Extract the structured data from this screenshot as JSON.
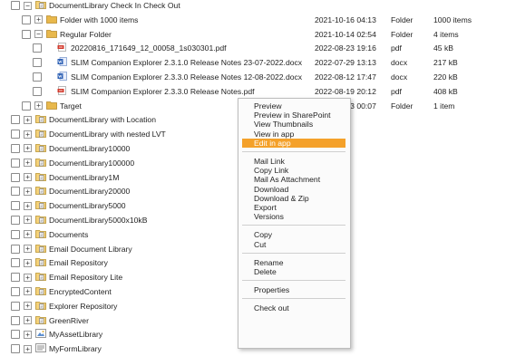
{
  "tree": [
    {
      "indent": 0,
      "expander": "minus",
      "icon": "library",
      "label": "DocumentLibrary Check In Check Out"
    },
    {
      "indent": 1,
      "expander": "plus",
      "icon": "folder",
      "label": "Folder with 1000 items",
      "date": "2021-10-16 04:13",
      "type": "Folder",
      "size": "1000 items"
    },
    {
      "indent": 1,
      "expander": "minus",
      "icon": "folder",
      "label": "Regular Folder",
      "date": "2021-10-14 02:54",
      "type": "Folder",
      "size": "4 items"
    },
    {
      "indent": 2,
      "expander": "",
      "icon": "pdf",
      "label": "20220816_171649_12_00058_1s030301.pdf",
      "date": "2022-08-23 19:16",
      "type": "pdf",
      "size": "45 kB"
    },
    {
      "indent": 2,
      "expander": "",
      "icon": "docx",
      "label": "SLIM Companion Explorer 2.3.1.0 Release Notes 23-07-2022.docx",
      "date": "2022-07-29 13:13",
      "type": "docx",
      "size": "217 kB"
    },
    {
      "indent": 2,
      "expander": "",
      "icon": "docx",
      "label": "SLIM Companion Explorer 2.3.3.0 Release Notes 12-08-2022.docx",
      "date": "2022-08-12 17:47",
      "type": "docx",
      "size": "220 kB"
    },
    {
      "indent": 2,
      "expander": "",
      "icon": "pdf",
      "label": "SLIM Companion Explorer 2.3.3.0 Release Notes.pdf",
      "date": "2022-08-19 20:12",
      "type": "pdf",
      "size": "408 kB"
    },
    {
      "indent": 1,
      "expander": "plus",
      "icon": "folder",
      "label": "Target",
      "date": "2021-10-03 00:07",
      "type": "Folder",
      "size": "1 item"
    },
    {
      "indent": 0,
      "expander": "plus",
      "icon": "library",
      "label": "DocumentLibrary with Location"
    },
    {
      "indent": 0,
      "expander": "plus",
      "icon": "library",
      "label": "DocumentLibrary with nested LVT"
    },
    {
      "indent": 0,
      "expander": "plus",
      "icon": "library",
      "label": "DocumentLibrary10000"
    },
    {
      "indent": 0,
      "expander": "plus",
      "icon": "library",
      "label": "DocumentLibrary100000"
    },
    {
      "indent": 0,
      "expander": "plus",
      "icon": "library",
      "label": "DocumentLibrary1M"
    },
    {
      "indent": 0,
      "expander": "plus",
      "icon": "library",
      "label": "DocumentLibrary20000"
    },
    {
      "indent": 0,
      "expander": "plus",
      "icon": "library",
      "label": "DocumentLibrary5000"
    },
    {
      "indent": 0,
      "expander": "plus",
      "icon": "library",
      "label": "DocumentLibrary5000x10kB"
    },
    {
      "indent": 0,
      "expander": "plus",
      "icon": "library",
      "label": "Documents"
    },
    {
      "indent": 0,
      "expander": "plus",
      "icon": "library",
      "label": "Email Document Library"
    },
    {
      "indent": 0,
      "expander": "plus",
      "icon": "library",
      "label": "Email Repository"
    },
    {
      "indent": 0,
      "expander": "plus",
      "icon": "library",
      "label": "Email Repository Lite"
    },
    {
      "indent": 0,
      "expander": "plus",
      "icon": "library",
      "label": "EncryptedContent"
    },
    {
      "indent": 0,
      "expander": "plus",
      "icon": "library",
      "label": "Explorer Repository"
    },
    {
      "indent": 0,
      "expander": "plus",
      "icon": "library",
      "label": "GreenRiver"
    },
    {
      "indent": 0,
      "expander": "plus",
      "icon": "asset",
      "label": "MyAssetLibrary"
    },
    {
      "indent": 0,
      "expander": "plus",
      "icon": "form",
      "label": "MyFormLibrary"
    }
  ],
  "context_menu": [
    {
      "label": "Preview"
    },
    {
      "label": "Preview in SharePoint"
    },
    {
      "label": "View Thumbnails"
    },
    {
      "label": "View in app"
    },
    {
      "label": "Edit in app",
      "highlighted": true
    },
    {
      "separator": true
    },
    {
      "label": "Mail Link"
    },
    {
      "label": "Copy Link"
    },
    {
      "label": "Mail As Attachment"
    },
    {
      "label": "Download"
    },
    {
      "label": "Download & Zip"
    },
    {
      "label": "Export"
    },
    {
      "label": "Versions"
    },
    {
      "separator": true
    },
    {
      "label": "Copy"
    },
    {
      "label": "Cut"
    },
    {
      "separator": true
    },
    {
      "label": "Rename"
    },
    {
      "label": "Delete"
    },
    {
      "separator": true
    },
    {
      "label": "Properties"
    },
    {
      "separator": true
    },
    {
      "label": "Check out"
    }
  ],
  "colors": {
    "menu_highlight": "#f4a12a",
    "folder": "#e8b84c",
    "pdf": "#d33a2c",
    "docx": "#2b5fb4"
  }
}
